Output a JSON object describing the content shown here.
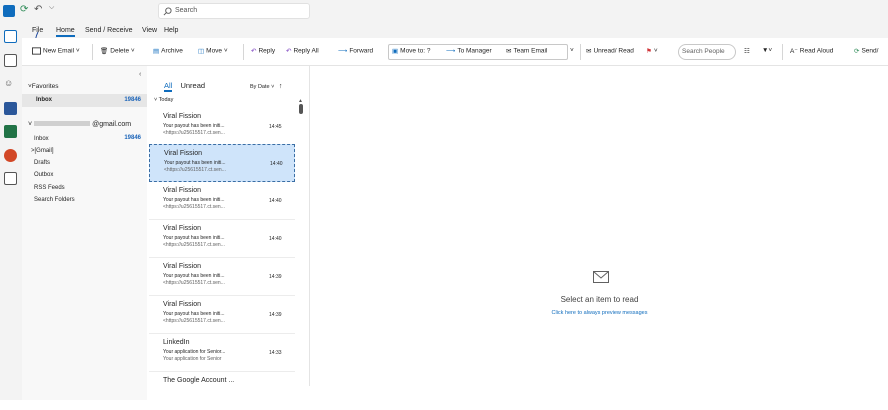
{
  "titlebar": {
    "search_placeholder": "Search"
  },
  "menu": {
    "file": "File",
    "home": "Home",
    "send_receive": "Send / Receive",
    "view": "View",
    "help": "Help"
  },
  "ribbon": {
    "new_email": "New Email",
    "delete": "Delete",
    "archive": "Archive",
    "move": "Move",
    "reply": "Reply",
    "reply_all": "Reply All",
    "forward": "Forward",
    "move_to": "Move to: ?",
    "to_manager": "To Manager",
    "team_email": "Team Email",
    "unread_read": "Unread/ Read",
    "search_people": "Search People",
    "read_aloud": "Read Aloud",
    "send_partial": "Send/"
  },
  "folders": {
    "favorites": "Favorites",
    "fav_inbox": "Inbox",
    "fav_inbox_count": "19846",
    "account": "@gmail.com",
    "inbox": "Inbox",
    "inbox_count": "19846",
    "gmail": "[Gmail]",
    "drafts": "Drafts",
    "outbox": "Outbox",
    "rss": "RSS Feeds",
    "search_folders": "Search Folders"
  },
  "list": {
    "tab_all": "All",
    "tab_unread": "Unread",
    "sort": "By Date",
    "group_today": "Today",
    "messages": [
      {
        "sender": "Viral Fission",
        "subject": "Your payout has been initi...",
        "preview": "<https://u25615517.ct.sen...",
        "time": "14:45"
      },
      {
        "sender": "Viral Fission",
        "subject": "Your payout has been initi...",
        "preview": "<https://u25615517.ct.sen...",
        "time": "14:40"
      },
      {
        "sender": "Viral Fission",
        "subject": "Your payout has been initi...",
        "preview": "<https://u25615517.ct.sen...",
        "time": "14:40"
      },
      {
        "sender": "Viral Fission",
        "subject": "Your payout has been initi...",
        "preview": "<https://u25615517.ct.sen...",
        "time": "14:40"
      },
      {
        "sender": "Viral Fission",
        "subject": "Your payout has been initi...",
        "preview": "<https://u25615517.ct.sen...",
        "time": "14:39"
      },
      {
        "sender": "Viral Fission",
        "subject": "Your payout has been initi...",
        "preview": "<https://u25615517.ct.sen...",
        "time": "14:39"
      },
      {
        "sender": "LinkedIn",
        "subject": "Your application for Senior...",
        "preview": "Your application for Senior",
        "time": "14:33"
      },
      {
        "sender": "The Google Account ...",
        "subject": "",
        "preview": "",
        "time": ""
      }
    ]
  },
  "reading": {
    "title": "Select an item to read",
    "link": "Click here to always preview messages"
  },
  "colors": {
    "accent": "#0f6cbd",
    "selected_row": "#cfe4fa",
    "flag": "#d13438"
  }
}
